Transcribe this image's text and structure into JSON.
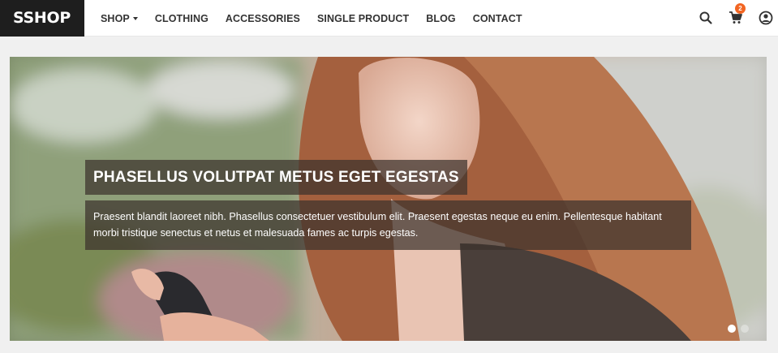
{
  "brand": {
    "name": "SSHOP"
  },
  "nav": {
    "items": [
      {
        "label": "SHOP",
        "has_dropdown": true
      },
      {
        "label": "CLOTHING"
      },
      {
        "label": "ACCESSORIES"
      },
      {
        "label": "SINGLE PRODUCT"
      },
      {
        "label": "BLOG"
      },
      {
        "label": "CONTACT"
      }
    ]
  },
  "actions": {
    "search_icon": "search-icon",
    "cart_icon": "cart-icon",
    "cart_count": "2",
    "user_icon": "user-icon"
  },
  "hero": {
    "title": "PHASELLUS VOLUTPAT METUS EGET EGESTAS",
    "text": "Praesent blandit laoreet nibh. Phasellus consectetuer vestibulum elit. Praesent egestas neque eu enim. Pellentesque habitant morbi tristique senectus et netus et malesuada fames ac turpis egestas.",
    "slides_total": 2,
    "slide_active": 1
  },
  "colors": {
    "accent": "#f26522",
    "logo_bg": "#1e1e1e"
  }
}
